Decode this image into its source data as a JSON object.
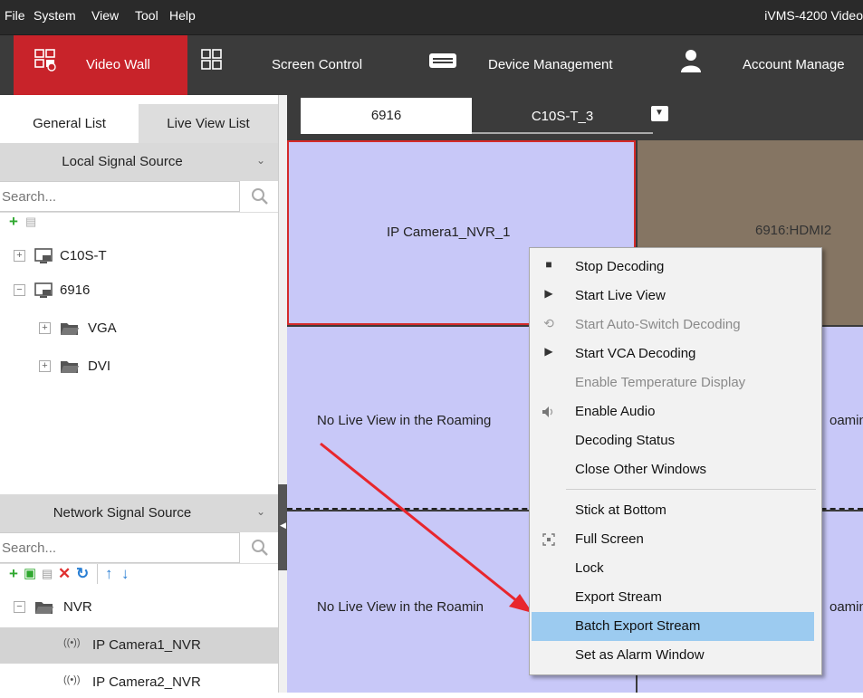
{
  "menubar": {
    "items": [
      "File",
      "System",
      "View",
      "Tool",
      "Help"
    ],
    "app_title": "iVMS-4200 Video"
  },
  "toolbar": {
    "tabs": [
      "Video Wall",
      "Screen Control",
      "Device Management",
      "Account Manage"
    ],
    "active_color": "#c8232a"
  },
  "left_panel": {
    "tabs": [
      "General List",
      "Live View List"
    ],
    "local_source": {
      "title": "Local Signal Source",
      "search_placeholder": "Search...",
      "tree": [
        {
          "label": "C10S-T",
          "expander": "+"
        },
        {
          "label": "6916",
          "expander": "−"
        },
        {
          "label": "VGA",
          "expander": "+"
        },
        {
          "label": "DVI",
          "expander": "+"
        }
      ]
    },
    "network_source": {
      "title": "Network Signal Source",
      "search_placeholder": "Search...",
      "tree": [
        {
          "label": "NVR",
          "expander": "−"
        },
        {
          "label": "IP Camera1_NVR"
        },
        {
          "label": "IP Camera2_NVR"
        }
      ]
    }
  },
  "screen_tabs": [
    "6916",
    "C10S-T_3"
  ],
  "wall": {
    "cells": [
      {
        "label": "IP Camera1_NVR_1"
      },
      {
        "label": "6916:HDMI2"
      },
      {
        "label": "No Live View in the Roaming"
      },
      {
        "label": "oamin"
      },
      {
        "label": "No Live View in the Roamin"
      },
      {
        "label": "oamin"
      }
    ]
  },
  "context_menu": {
    "items": [
      {
        "label": "Stop Decoding",
        "icon": "stop-icon",
        "glyph": "■",
        "disabled": false
      },
      {
        "label": "Start Live View",
        "icon": "play-icon",
        "glyph": "▶",
        "disabled": false
      },
      {
        "label": "Start Auto-Switch Decoding",
        "icon": "auto-switch-icon",
        "glyph": "⟲",
        "disabled": true
      },
      {
        "label": "Start VCA Decoding",
        "icon": "play-icon",
        "glyph": "▶",
        "disabled": false
      },
      {
        "label": "Enable Temperature Display",
        "icon": "",
        "glyph": "",
        "disabled": true
      },
      {
        "label": "Enable Audio",
        "icon": "speaker-icon",
        "glyph": "🔈",
        "disabled": false
      },
      {
        "label": "Decoding Status",
        "icon": "",
        "glyph": "",
        "disabled": false
      },
      {
        "label": "Close Other Windows",
        "icon": "",
        "glyph": "",
        "disabled": false
      },
      {
        "label": "Stick at Bottom",
        "icon": "",
        "glyph": "",
        "disabled": false
      },
      {
        "label": "Full Screen",
        "icon": "fullscreen-icon",
        "glyph": "⌗",
        "disabled": false
      },
      {
        "label": "Lock",
        "icon": "",
        "glyph": "",
        "disabled": false
      },
      {
        "label": "Export Stream",
        "icon": "",
        "glyph": "",
        "disabled": false
      },
      {
        "label": "Batch Export Stream",
        "icon": "",
        "glyph": "",
        "disabled": false,
        "highlighted": true
      },
      {
        "label": "Set as Alarm Window",
        "icon": "",
        "glyph": "",
        "disabled": false
      }
    ],
    "highlight_color": "#9ccbf0"
  },
  "annotation": {
    "arrow_color": "#e8262d"
  }
}
